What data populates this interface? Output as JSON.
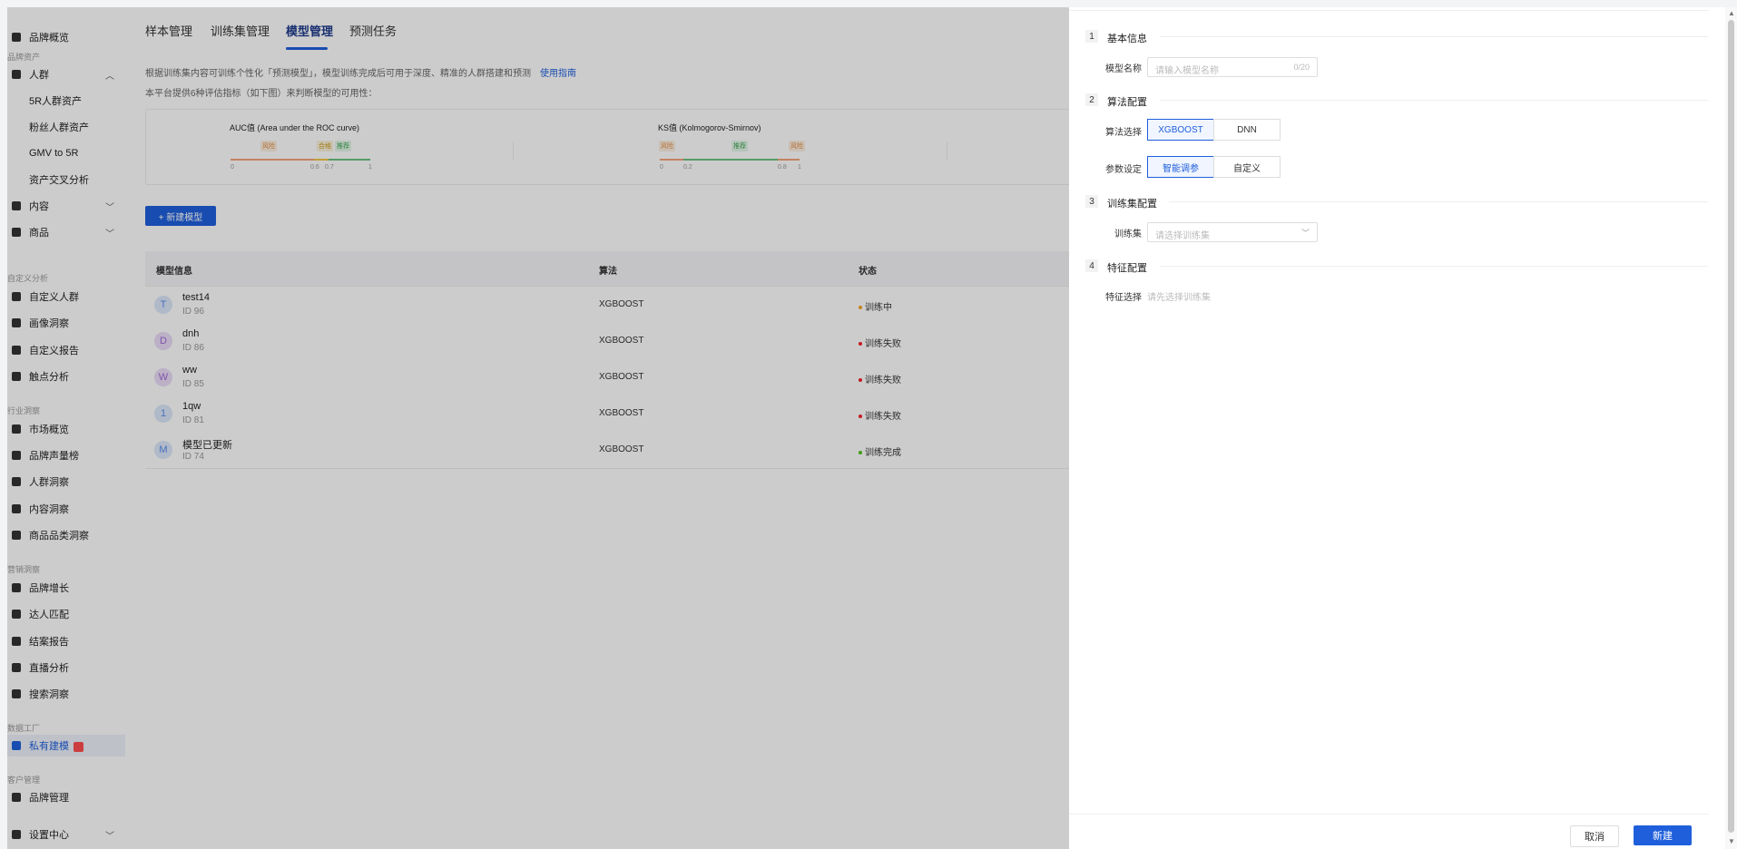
{
  "sidebar": {
    "groups": [
      "品牌资产",
      "自定义分析",
      "行业洞察",
      "营销洞察",
      "数据工厂",
      "客户管理"
    ],
    "items": [
      {
        "label": "品牌概览",
        "icon": "grid-icon"
      },
      {
        "label": "人群",
        "icon": "people-icon"
      },
      {
        "label": "5R人群资产",
        "icon": ""
      },
      {
        "label": "粉丝人群资产",
        "icon": ""
      },
      {
        "label": "GMV to 5R",
        "icon": ""
      },
      {
        "label": "资产交叉分析",
        "icon": ""
      },
      {
        "label": "内容",
        "icon": "content-icon"
      },
      {
        "label": "商品",
        "icon": "goods-icon"
      },
      {
        "label": "自定义人群",
        "icon": "user-edit-icon"
      },
      {
        "label": "画像洞察",
        "icon": "portrait-icon"
      },
      {
        "label": "自定义报告",
        "icon": "report-icon"
      },
      {
        "label": "触点分析",
        "icon": "touchpoint-icon"
      },
      {
        "label": "市场概览",
        "icon": "market-icon"
      },
      {
        "label": "品牌声量榜",
        "icon": "chart-icon"
      },
      {
        "label": "人群洞察",
        "icon": "crowd-icon"
      },
      {
        "label": "内容洞察",
        "icon": "content-insight-icon"
      },
      {
        "label": "商品品类洞察",
        "icon": "category-icon"
      },
      {
        "label": "品牌增长",
        "icon": "growth-icon"
      },
      {
        "label": "达人匹配",
        "icon": "match-icon"
      },
      {
        "label": "结案报告",
        "icon": "summary-icon"
      },
      {
        "label": "直播分析",
        "icon": "live-icon"
      },
      {
        "label": "搜索洞察",
        "icon": "search-icon"
      },
      {
        "label": "私有建模",
        "icon": "modeling-icon"
      },
      {
        "label": "品牌管理",
        "icon": "brand-icon"
      },
      {
        "label": "设置中心",
        "icon": "settings-icon"
      }
    ]
  },
  "tabs": [
    "样本管理",
    "训练集管理",
    "模型管理",
    "预测任务"
  ],
  "description": {
    "line1": "根据训练集内容可训练个性化「预测模型」，模型训练完成后可用于深度、精准的人群搭建和预测",
    "guide_link": "使用指南",
    "line2": "本平台提供6种评估指标（如下图）来判断模型的可用性："
  },
  "metrics": [
    {
      "title": "AUC值 (Area under the ROC curve)",
      "zones": [
        "风险",
        "合格",
        "推荐"
      ],
      "ticks": [
        "0",
        "0.6",
        "0.7",
        "1"
      ]
    },
    {
      "title": "KS值 (Kolmogorov-Smirnov)",
      "zones": [
        "风险",
        "推荐",
        "风险"
      ],
      "ticks": [
        "0",
        "0.2",
        "0.8",
        "1"
      ]
    }
  ],
  "new_model_button": "+ 新建模型",
  "table": {
    "headers": [
      "模型信息",
      "算法",
      "状态"
    ],
    "rows": [
      {
        "avatar": "T",
        "name": "test14",
        "id": "ID 96",
        "algorithm": "XGBOOST",
        "status": "训练中",
        "status_color": "#f5a623",
        "avatar_color": "#dbe8fb",
        "avatar_text": "#5b8def"
      },
      {
        "avatar": "D",
        "name": "dnh",
        "id": "ID 86",
        "algorithm": "XGBOOST",
        "status": "训练失败",
        "status_color": "#f5222d",
        "avatar_color": "#eadcf7",
        "avatar_text": "#a26ad8"
      },
      {
        "avatar": "W",
        "name": "ww",
        "id": "ID 85",
        "algorithm": "XGBOOST",
        "status": "训练失败",
        "status_color": "#f5222d",
        "avatar_color": "#eadcf7",
        "avatar_text": "#a26ad8"
      },
      {
        "avatar": "1",
        "name": "1qw",
        "id": "ID 81",
        "algorithm": "XGBOOST",
        "status": "训练失败",
        "status_color": "#f5222d",
        "avatar_color": "#dbe8fb",
        "avatar_text": "#5b8def"
      },
      {
        "avatar": "M",
        "name": "模型已更新",
        "id": "ID 74",
        "algorithm": "XGBOOST",
        "status": "训练完成",
        "status_color": "#52c41a",
        "avatar_color": "#dbe8fb",
        "avatar_text": "#5b8def"
      }
    ]
  },
  "drawer": {
    "sections": [
      {
        "num": "1",
        "title": "基本信息"
      },
      {
        "num": "2",
        "title": "算法配置"
      },
      {
        "num": "3",
        "title": "训练集配置"
      },
      {
        "num": "4",
        "title": "特征配置"
      }
    ],
    "model_name": {
      "label": "模型名称",
      "placeholder": "请输入模型名称",
      "counter": "0/20"
    },
    "algorithm": {
      "label": "算法选择",
      "options": [
        "XGBOOST",
        "DNN"
      ],
      "selected": "XGBOOST"
    },
    "params": {
      "label": "参数设定",
      "options": [
        "智能调参",
        "自定义"
      ],
      "selected": "智能调参"
    },
    "training_set": {
      "label": "训练集",
      "placeholder": "请选择训练集"
    },
    "features": {
      "label": "特征选择",
      "hint": "请先选择训练集"
    },
    "cancel": "取消",
    "create": "新建"
  },
  "colors": {
    "accent": "#1f5fdc",
    "overlay": "rgba(0,0,0,0.2)"
  }
}
